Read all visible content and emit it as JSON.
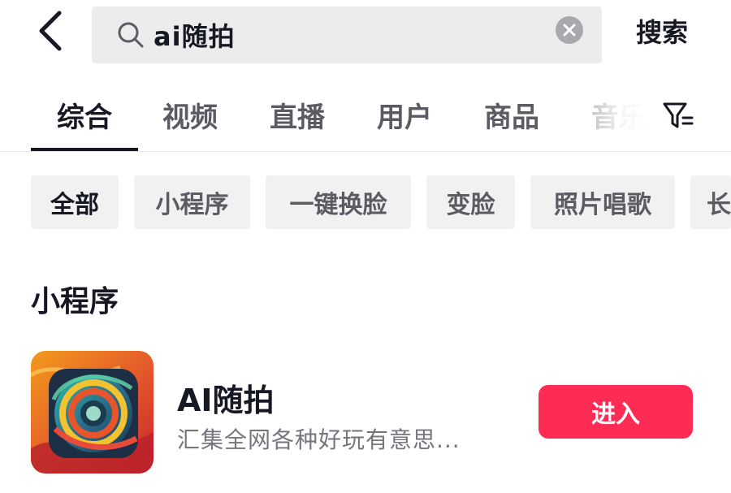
{
  "search": {
    "query": "ai随拍",
    "submit_label": "搜索"
  },
  "tabs": [
    {
      "label": "综合",
      "active": true
    },
    {
      "label": "视频"
    },
    {
      "label": "直播"
    },
    {
      "label": "用户"
    },
    {
      "label": "商品"
    },
    {
      "label": "音乐"
    }
  ],
  "chips": [
    {
      "label": "全部",
      "active": true
    },
    {
      "label": "小程序"
    },
    {
      "label": "一键换脸"
    },
    {
      "label": "变脸"
    },
    {
      "label": "照片唱歌"
    },
    {
      "label": "长"
    }
  ],
  "section": {
    "title": "小程序"
  },
  "app": {
    "name": "AI随拍",
    "description": "汇集全网各种好玩有意思...",
    "action_label": "进入"
  },
  "colors": {
    "accent": "#fe2c55",
    "text_primary": "#161823",
    "text_secondary": "#5a5b63",
    "chip_bg": "#f1f1f2",
    "search_bg": "#ececec"
  },
  "icons": {
    "back": "back-arrow-icon",
    "search": "search-icon",
    "clear": "clear-icon",
    "filter": "filter-icon",
    "app": "app-logo-icon"
  }
}
